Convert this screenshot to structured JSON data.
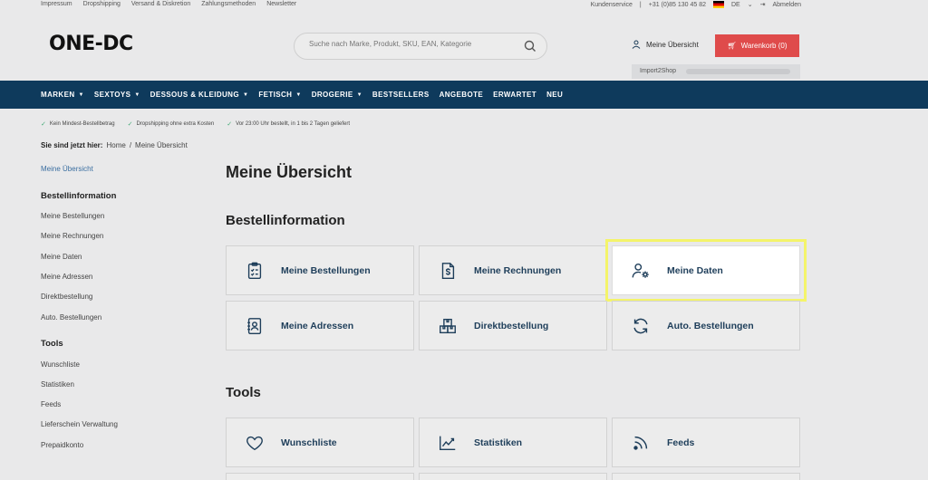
{
  "topbar": {
    "links": [
      "Impressum",
      "Dropshipping",
      "Versand & Diskretion",
      "Zahlungsmethoden",
      "Newsletter"
    ],
    "kundenservice": "Kundenservice",
    "phone": "+31 (0)85 130 45 82",
    "lang": "DE",
    "logout": "Abmelden"
  },
  "header": {
    "logo": "ONE-DC",
    "search_placeholder": "Suche nach Marke, Produkt, SKU, EAN, Kategorie",
    "account": "Meine Übersicht",
    "cart": "Warenkorb (0)",
    "import_label": "Import2Shop"
  },
  "nav": [
    "MARKEN",
    "SEXTOYS",
    "DESSOUS & KLEIDUNG",
    "FETISCH",
    "DROGERIE",
    "BESTSELLERS",
    "ANGEBOTE",
    "ERWARTET",
    "NEU"
  ],
  "nav_dropdown": [
    true,
    true,
    true,
    true,
    true,
    false,
    false,
    false,
    false
  ],
  "usp": [
    "Kein Mindest-Bestellbetrag",
    "Dropshipping ohne extra Kosten",
    "Vor 23:00 Uhr bestellt, in 1 bis 2 Tagen geliefert"
  ],
  "breadcrumb": {
    "label": "Sie sind jetzt hier:",
    "home": "Home",
    "sep": "/",
    "current": "Meine Übersicht"
  },
  "sidebar": {
    "overview": "Meine Übersicht",
    "section1": "Bestellinformation",
    "items1": [
      "Meine Bestellungen",
      "Meine Rechnungen",
      "Meine Daten",
      "Meine Adressen",
      "Direktbestellung",
      "Auto. Bestellungen"
    ],
    "section2": "Tools",
    "items2": [
      "Wunschliste",
      "Statistiken",
      "Feeds",
      "Lieferschein Verwaltung",
      "Prepaidkonto"
    ]
  },
  "main": {
    "title": "Meine Übersicht",
    "section1": "Bestellinformation",
    "cards1": [
      "Meine Bestellungen",
      "Meine Rechnungen",
      "Meine Daten",
      "Meine Adressen",
      "Direktbestellung",
      "Auto. Bestellungen"
    ],
    "section2": "Tools",
    "cards2": [
      "Wunschliste",
      "Statistiken",
      "Feeds"
    ]
  },
  "colors": {
    "nav": "#0e3a5c",
    "cart": "#df4b4b",
    "highlight": "#f4f46a",
    "card_text": "#1e3e5a"
  }
}
